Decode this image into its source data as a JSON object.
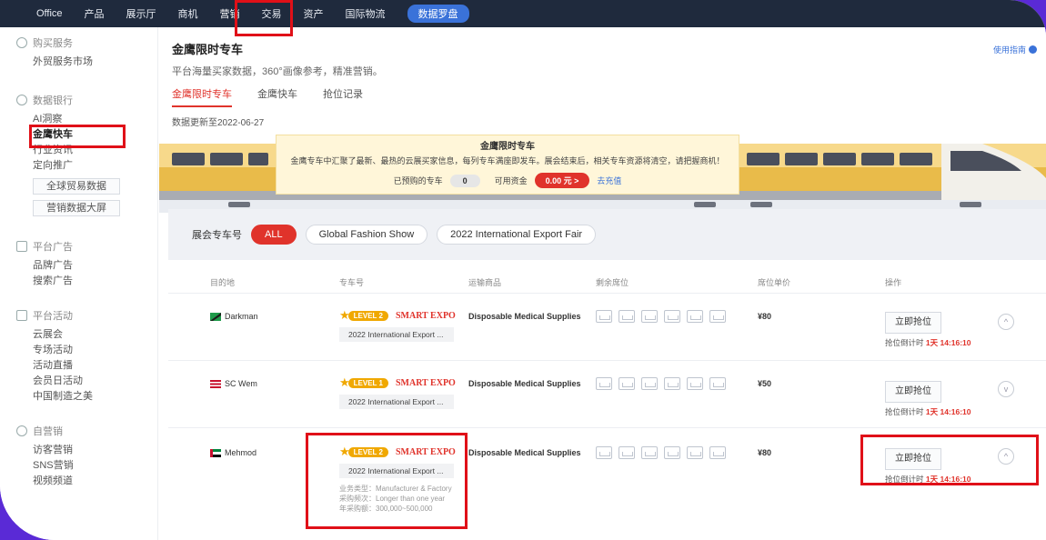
{
  "topnav": {
    "items": [
      "Office",
      "产品",
      "展示厅",
      "商机",
      "营销",
      "交易",
      "资产",
      "国际物流"
    ],
    "pill": "数据罗盘"
  },
  "sidebar": {
    "groups": [
      {
        "title": "购买服务",
        "items": [
          "外贸服务市场"
        ]
      },
      {
        "title": "数据银行",
        "items": [
          "AI洞察",
          "金鹰快车",
          "行业资讯",
          "定向推广"
        ],
        "boxes": [
          "全球贸易数据",
          "营销数据大屏"
        ]
      },
      {
        "title": "平台广告",
        "items": [
          "品牌广告",
          "搜索广告"
        ]
      },
      {
        "title": "平台活动",
        "items": [
          "云展会",
          "专场活动",
          "活动直播",
          "会员日活动",
          "中国制造之美"
        ]
      },
      {
        "title": "自营销",
        "items": [
          "访客营销",
          "SNS营销",
          "视频频道"
        ]
      }
    ]
  },
  "page": {
    "title": "金鹰限时专车",
    "subtitle": "平台海量买家数据，360°画像参考，精准营销。",
    "help": "使用指南",
    "tabs": [
      "金鹰限时专车",
      "金鹰快车",
      "抢位记录"
    ],
    "update": "数据更新至2022-06-27"
  },
  "banner": {
    "title": "金鹰限时专车",
    "desc": "金鹰专车中汇聚了最新、最热的云展买家信息，每列专车满座即发车。展会结束后，相关专车资源将清空，请把握商机！",
    "booked_label": "已预购的专车",
    "booked_value": "0",
    "funds_label": "可用资金",
    "funds_value": "0.00 元 >",
    "recharge": "去充值"
  },
  "filter": {
    "label": "展会专车号",
    "chips": [
      "ALL",
      "Global Fashion Show",
      "2022 International Export Fair"
    ]
  },
  "table": {
    "headers": [
      "目的地",
      "专车号",
      "运输商品",
      "剩余席位",
      "席位单价",
      "操作"
    ],
    "rows": [
      {
        "dest": "Darkman",
        "level": "LEVEL 2",
        "brand": "SMART EXPO",
        "expo": "2022 International Export ...",
        "goods": "Disposable Medical Supplies",
        "price": "¥80",
        "button": "立即抢位",
        "countdown_label": "抢位倒计时",
        "countdown": "1天 14:16:10",
        "toggle": "^"
      },
      {
        "dest": "SC Wem",
        "level": "LEVEL 1",
        "brand": "SMART EXPO",
        "expo": "2022 International Export ...",
        "goods": "Disposable Medical Supplies",
        "price": "¥50",
        "button": "立即抢位",
        "countdown_label": "抢位倒计时",
        "countdown": "1天 14:16:10",
        "toggle": "v"
      },
      {
        "dest": "Mehmod",
        "level": "LEVEL 2",
        "brand": "SMART EXPO",
        "expo": "2022 International Export ...",
        "goods": "Disposable Medical Supplies",
        "price": "¥80",
        "button": "立即抢位",
        "countdown_label": "抢位倒计时",
        "countdown": "1天 14:16:10",
        "toggle": "^",
        "meta": [
          "业务类型：Manufacturer & Factory",
          "采购频次：Longer than one year",
          "年采购额：300,000~500,000"
        ]
      }
    ]
  },
  "colors": {
    "accent": "#e0332b",
    "nav": "#1f2a3d",
    "link": "#3a72d9",
    "level": "#f0a800"
  }
}
